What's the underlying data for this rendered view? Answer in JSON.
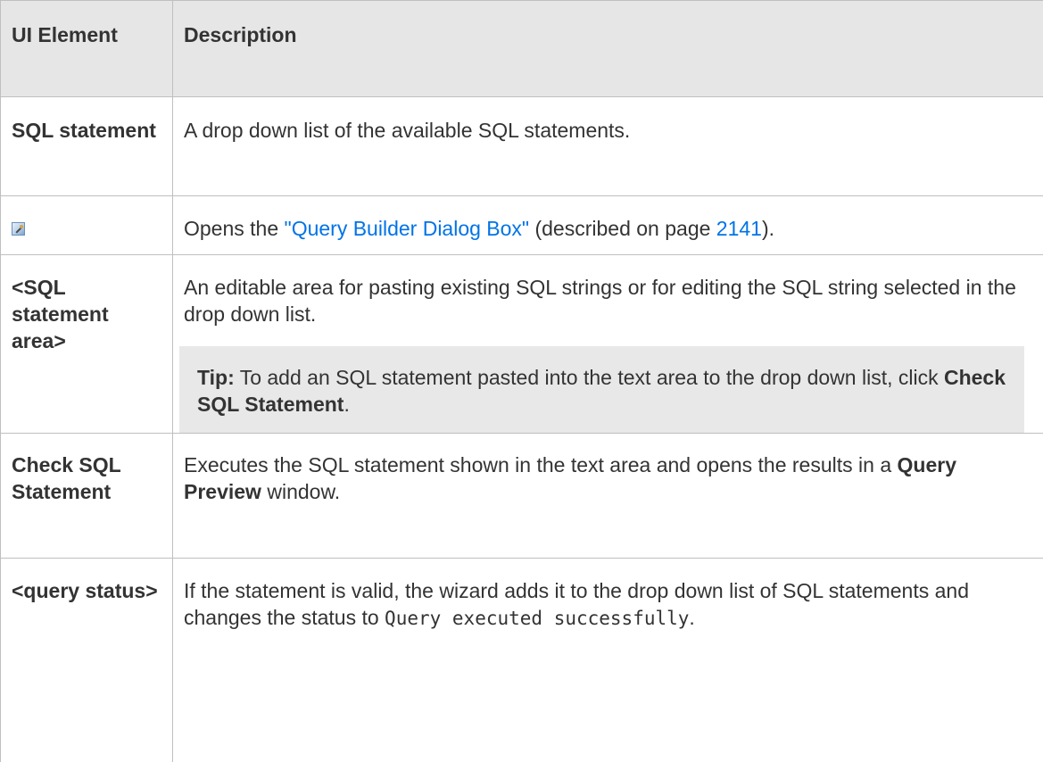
{
  "header": {
    "col1": "UI Element",
    "col2": "Description"
  },
  "rows": [
    {
      "label": "SQL statement",
      "description": "A drop down list of the available SQL statements."
    },
    {
      "icon": "query-builder-icon",
      "description_pre": "Opens the ",
      "link_text": "\"Query Builder Dialog Box\"",
      "description_mid": " (described on page ",
      "page_link": "2141",
      "description_post": ")."
    },
    {
      "label": "<SQL statement area>",
      "description": "An editable area for pasting existing SQL strings or for editing the SQL string selected in the drop down list.",
      "tip": {
        "label": "Tip:",
        "text": " To add an SQL statement pasted into the text area to the drop down list, click ",
        "bold": "Check SQL Statement",
        "end": "."
      }
    },
    {
      "label": "Check SQL Statement",
      "description_pre": "Executes the SQL statement shown in the text area and opens the results in a ",
      "bold": "Query Preview",
      "description_post": " window."
    },
    {
      "label": "<query status>",
      "description_pre": "If the statement is valid, the wizard adds it to the drop down list of SQL statements and changes the status to ",
      "code": "Query executed successfully",
      "description_post": "."
    }
  ],
  "colors": {
    "header_bg": "#e6e6e6",
    "tip_bg": "#e8e8e8",
    "link": "#0073e7",
    "text": "#333333",
    "border": "#bfbfbf"
  }
}
